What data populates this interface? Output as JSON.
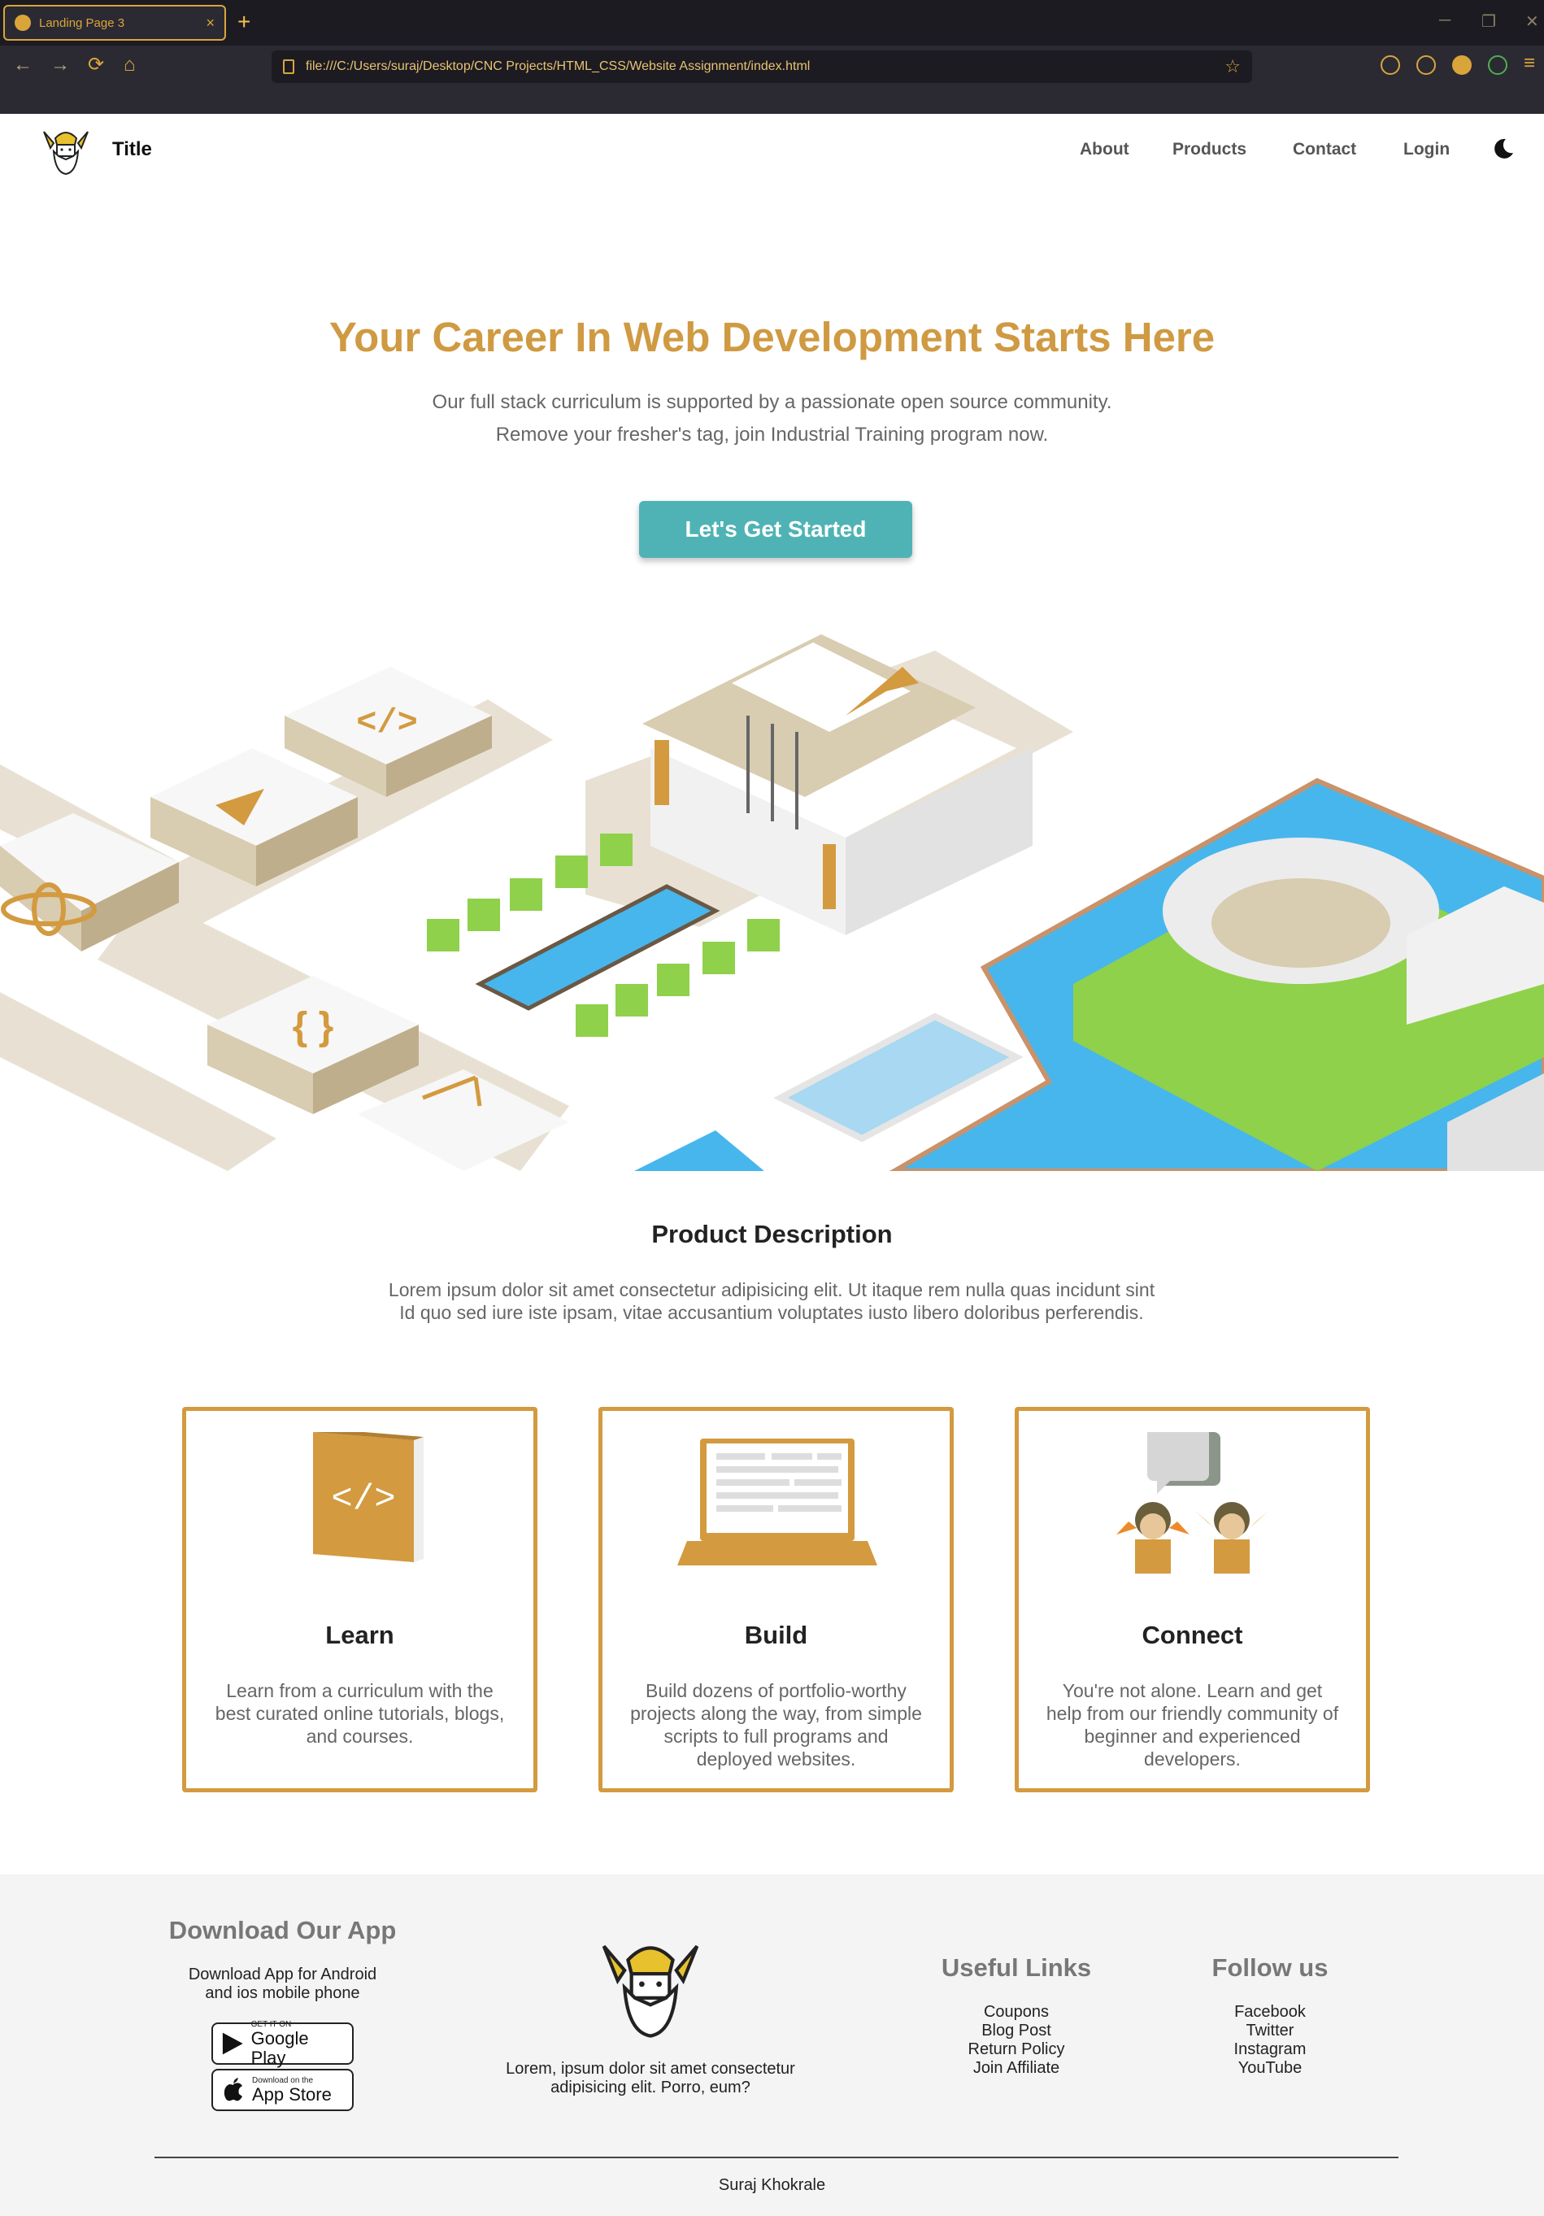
{
  "browser": {
    "tab_title": "Landing Page 3",
    "tab_close": "×",
    "new_tab": "+",
    "url": "file:///C:/Users/suraj/Desktop/CNC Projects/HTML_CSS/Website Assignment/index.html",
    "back": "←",
    "forward": "→",
    "reload": "⟳",
    "home": "⌂",
    "star": "☆",
    "menu": "≡",
    "minimize": "─",
    "restore": "❐",
    "close": "✕"
  },
  "header": {
    "title": "Title",
    "nav": [
      "About",
      "Products",
      "Contact",
      "Login"
    ]
  },
  "hero": {
    "title": "Your Career In Web Development Starts Here",
    "line1": "Our full stack curriculum is supported by a passionate open source community.",
    "line2": "Remove your fresher's tag, join Industrial Training program now.",
    "cta": "Let's Get Started"
  },
  "product": {
    "title": "Product Description",
    "text": "Lorem ipsum dolor sit amet consectetur adipisicing elit. Ut itaque rem nulla quas incidunt sint Id quo sed iure iste ipsam, vitae accusantium voluptates iusto libero doloribus perferendis."
  },
  "cards": [
    {
      "title": "Learn",
      "text": "Learn from a curriculum with the best curated online tutorials, blogs, and courses."
    },
    {
      "title": "Build",
      "text": "Build dozens of portfolio-worthy projects along the way, from simple scripts to full programs and deployed websites."
    },
    {
      "title": "Connect",
      "text": "You're not alone. Learn and get help from our friendly community of beginner and experienced developers."
    }
  ],
  "footer": {
    "download_title": "Download Our App",
    "download_text_1": "Download App for Android",
    "download_text_2": "and ios mobile phone",
    "google_small": "GET IT ON",
    "google_big": "Google Play",
    "apple_small": "Download on the",
    "apple_big": "App Store",
    "about_text_1": "Lorem, ipsum dolor sit amet consectetur",
    "about_text_2": "adipisicing elit. Porro, eum?",
    "links_title": "Useful Links",
    "links": [
      "Coupons",
      "Blog Post",
      "Return Policy",
      "Join Affiliate"
    ],
    "follow_title": "Follow us",
    "social": [
      "Facebook",
      "Twitter",
      "Instagram",
      "YouTube"
    ],
    "credit": "Suraj Khokrale"
  },
  "colors": {
    "accent": "#cf9a42",
    "cta": "#4fb3b5",
    "card_border": "#d39a3f",
    "footer_bg": "#f4f4f4"
  }
}
